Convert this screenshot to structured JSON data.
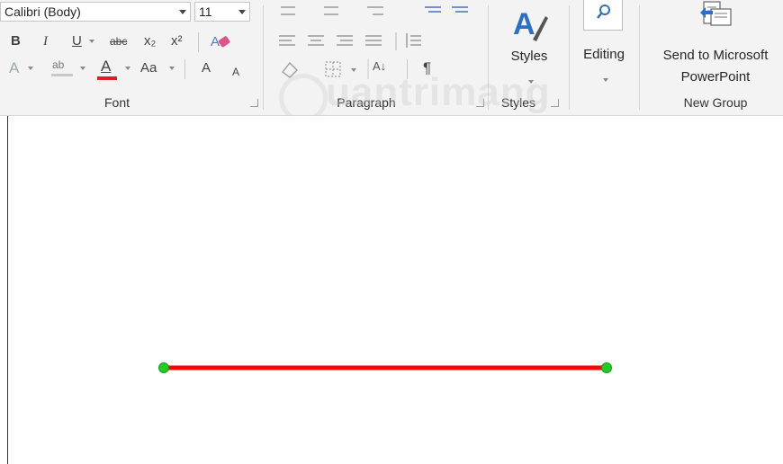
{
  "font_group": {
    "font_name": "Calibri (Body)",
    "font_size": "11",
    "bold": "B",
    "italic": "I",
    "underline": "U",
    "strikethrough": "abc",
    "subscript": "x₂",
    "superscript": "x²",
    "text_effects": "A",
    "highlight": "ab",
    "font_color": "A",
    "change_case": "Aa",
    "grow_font": "A",
    "shrink_font": "A",
    "label": "Font"
  },
  "paragraph_group": {
    "pilcrow": "¶",
    "sort": "A↓",
    "label": "Paragraph"
  },
  "styles_group": {
    "styles_button": "Styles",
    "label": "Styles"
  },
  "editing_group": {
    "editing_button": "Editing"
  },
  "new_group": {
    "send_button_line1": "Send to Microsoft",
    "send_button_line2": "PowerPoint",
    "label": "New Group"
  },
  "watermark": "uantrimang",
  "colors": {
    "line": "#ff0000",
    "handle": "#22cc22",
    "font_color_bar": "#e02020",
    "styles_icon": "#2b6fc7"
  }
}
